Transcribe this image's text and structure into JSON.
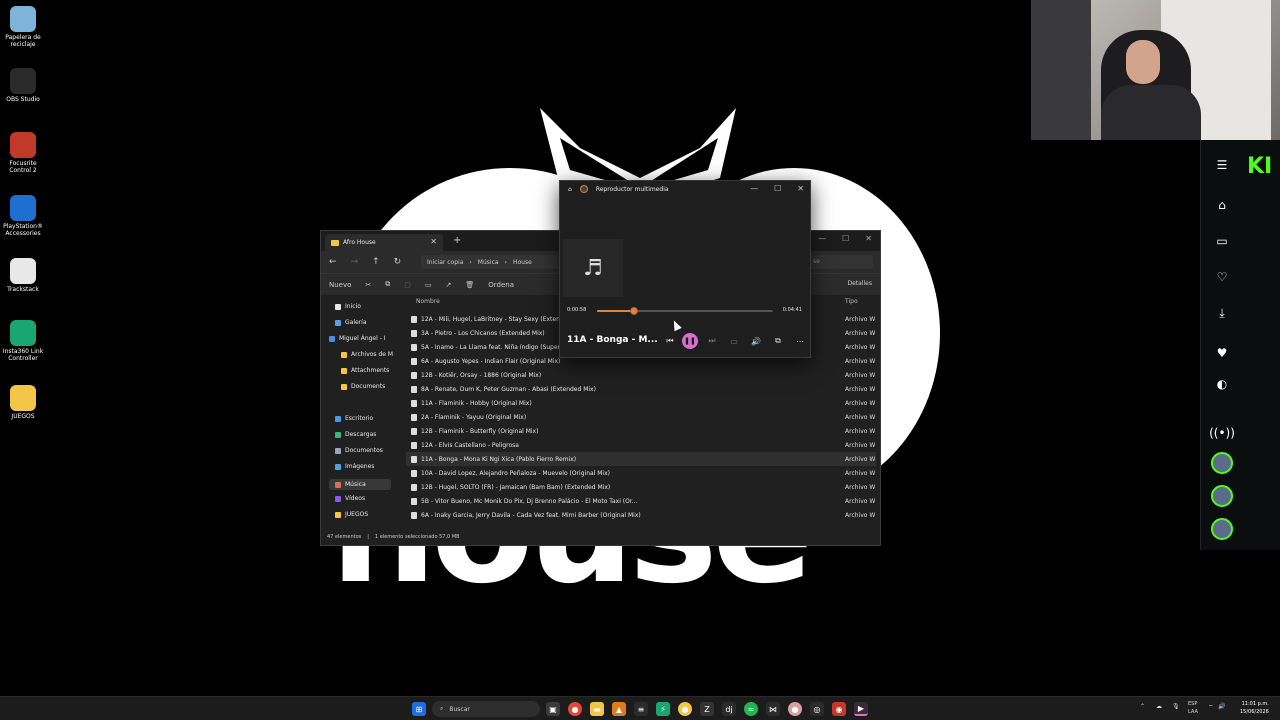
{
  "desktop": {
    "wallpaper_text": "house",
    "icons": [
      {
        "label": "Papelera de reciclaje",
        "icon": "recycle-bin-icon",
        "color": "#7fb3d9"
      },
      {
        "label": "OBS Studio",
        "icon": "obs-icon",
        "color": "#2b2b2b"
      },
      {
        "label": "Focusrite Control 2",
        "icon": "focusrite-icon",
        "color": "#c0392b"
      },
      {
        "label": "PlayStation® Accessories",
        "icon": "playstation-icon",
        "color": "#1f6fd1"
      },
      {
        "label": "Trackstack",
        "icon": "trackstack-icon",
        "color": "#e8e8e8"
      },
      {
        "label": "Insta360 Link Controller",
        "icon": "insta360-icon",
        "color": "#1aa672"
      },
      {
        "label": "JUEGOS",
        "icon": "folder-icon",
        "color": "#f3c548"
      }
    ]
  },
  "side_app": {
    "logo": "KI",
    "accent": "#53fc18"
  },
  "explorer": {
    "tab_title": "Afro House",
    "new_tab": "+",
    "breadcrumb": [
      "Iniciar copia",
      "Música",
      "House"
    ],
    "search_placeholder": "se",
    "toolbar": {
      "new_label": "Nuevo",
      "sort_label": "Ordena",
      "details_label": "Detalles"
    },
    "nav": [
      {
        "label": "Inicio",
        "icon": "home-icon",
        "color": "#e8e8e8"
      },
      {
        "label": "Galería",
        "icon": "gallery-icon",
        "color": "#5aa0e0"
      },
      {
        "label": "Miguel Ángel - I",
        "icon": "cloud-icon",
        "color": "#4a90d9"
      },
      {
        "label": "Archivos de M",
        "icon": "folder-icon",
        "color": "#f3c548"
      },
      {
        "label": "Attachments",
        "icon": "folder-icon",
        "color": "#f3c548"
      },
      {
        "label": "Documents",
        "icon": "folder-icon",
        "color": "#f3c548"
      },
      {
        "label": "Escritorio",
        "icon": "desktop-icon",
        "color": "#4a9be0"
      },
      {
        "label": "Descargas",
        "icon": "download-icon",
        "color": "#3fb27f"
      },
      {
        "label": "Documentos",
        "icon": "document-icon",
        "color": "#9aa7b8"
      },
      {
        "label": "Imágenes",
        "icon": "image-icon",
        "color": "#4fa3e0"
      },
      {
        "label": "Música",
        "icon": "music-icon",
        "color": "#e06a55"
      },
      {
        "label": "Vídeos",
        "icon": "video-icon",
        "color": "#8a5be0"
      },
      {
        "label": "JUEGOS",
        "icon": "folder-icon",
        "color": "#f3c548"
      },
      {
        "label": "Tech House",
        "icon": "folder-icon",
        "color": "#f3c548"
      }
    ],
    "columns": {
      "name": "Nombre",
      "type": "Tipo"
    },
    "files": [
      "12A - Mili, Hugel, LaBritney - Stay Sexy (Extended Mi",
      "3A - Pietro - Los Chicanos (Extended Mix)",
      "5A - Inamo - La Llama feat. Niña índigo (Super Flu Re",
      "6A - Augusto Yepes - Indian Flair (Original Mix)",
      "12B - Kotiêr, Orsay - 1886 (Original Mix)",
      "8A - Renate, Dum K, Peter Guzman - Abasi (Extended Mix)",
      "11A - Flaminik - Hobby (Original Mix)",
      "2A - Flaminik - Yayuu (Original Mix)",
      "12B - Flaminik - Butterfly (Original Mix)",
      "12A - Elvis Castellano - Peligrosa",
      "11A - Bonga - Mona Ki Ngi Xica (Pablo Fierro Remix)",
      "10A - David Lopez, Alejandro Peñaloza - Muevelo (Original Mix)",
      "12B - Hugel, SOLTO (FR) - Jamaican (Bam Bam) (Extended Mix)",
      "5B - Vitor Bueno, Mc Monik Do Pix, Dj Brenno Palácio - El Moto Taxi (Or...",
      "6A - Inaky Garcia, Jerry Davila - Cada Vez feat. Mimi Barber (Original Mix)"
    ],
    "file_type": "Archivo W",
    "selected_index": 10,
    "status": {
      "count": "47 elementos",
      "selection": "1 elemento seleccionado  57,0 MB"
    }
  },
  "player": {
    "title": "Reproductor multimedia",
    "current_time": "0:00:58",
    "total_time": "0:04:41",
    "progress": 0.21,
    "song": "11A - Bonga - M...",
    "accent": "#e0843d"
  },
  "taskbar": {
    "search_label": "Buscar",
    "lang": "ESP",
    "lang2": "LAA",
    "time": "11:01 p.m.",
    "date": "15/06/2026"
  }
}
